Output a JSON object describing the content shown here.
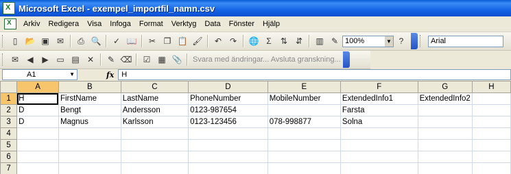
{
  "window": {
    "title": "Microsoft Excel - exempel_importfil_namn.csv"
  },
  "menu": [
    "Arkiv",
    "Redigera",
    "Visa",
    "Infoga",
    "Format",
    "Verktyg",
    "Data",
    "Fönster",
    "Hjälp"
  ],
  "toolbar": {
    "zoom": "100%",
    "font": "Arial"
  },
  "review_toolbar": {
    "text": "Svara med ändringar... Avsluta granskning..."
  },
  "formula_bar": {
    "name_box": "A1",
    "fx_label": "fx",
    "value": "H"
  },
  "sheet": {
    "columns": [
      "A",
      "B",
      "C",
      "D",
      "E",
      "F",
      "G",
      "H"
    ],
    "rows": [
      {
        "num": "1",
        "cells": [
          "H",
          "FirstName",
          "LastName",
          "PhoneNumber",
          "MobileNumber",
          "ExtendedInfo1",
          "ExtendedInfo2",
          ""
        ]
      },
      {
        "num": "2",
        "cells": [
          "D",
          "Bengt",
          "Andersson",
          "0123-987654",
          "",
          "Farsta",
          "",
          ""
        ]
      },
      {
        "num": "3",
        "cells": [
          "D",
          "Magnus",
          "Karlsson",
          "0123-123456",
          "078-998877",
          "Solna",
          "",
          ""
        ]
      },
      {
        "num": "4",
        "cells": [
          "",
          "",
          "",
          "",
          "",
          "",
          "",
          ""
        ]
      },
      {
        "num": "5",
        "cells": [
          "",
          "",
          "",
          "",
          "",
          "",
          "",
          ""
        ]
      },
      {
        "num": "6",
        "cells": [
          "",
          "",
          "",
          "",
          "",
          "",
          "",
          ""
        ]
      },
      {
        "num": "7",
        "cells": [
          "",
          "",
          "",
          "",
          "",
          "",
          "",
          ""
        ]
      }
    ]
  }
}
